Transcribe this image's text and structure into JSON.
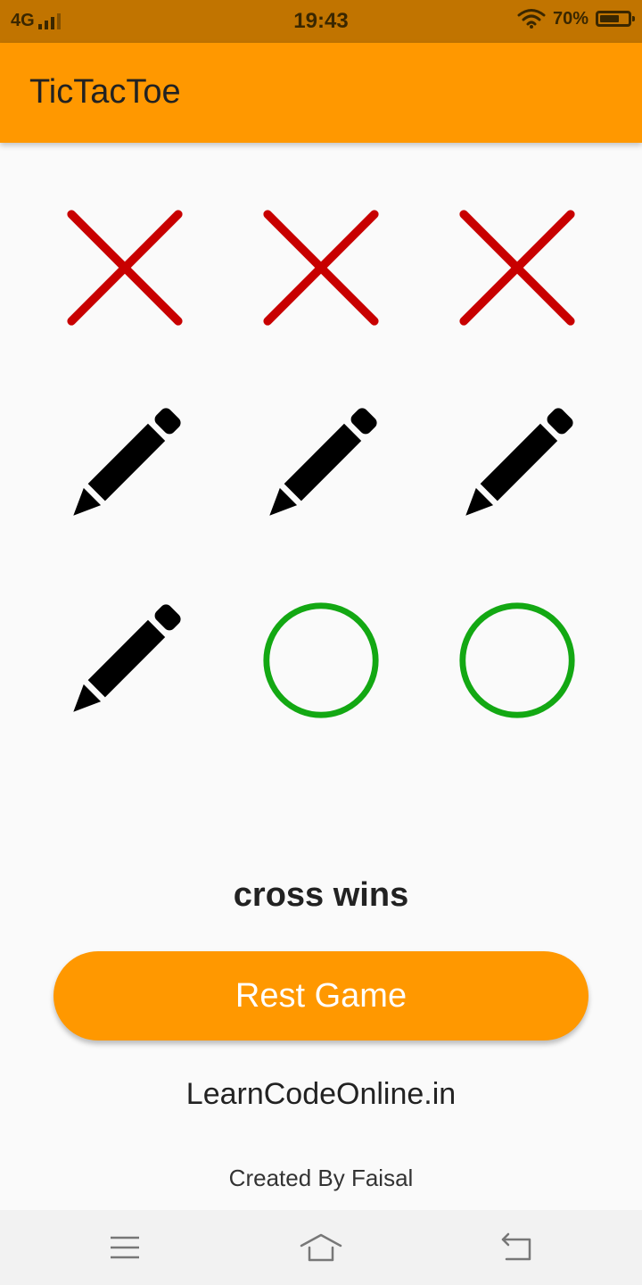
{
  "status_bar": {
    "network": "4G",
    "time": "19:43",
    "battery": "70%",
    "battery_level": 0.7
  },
  "app_bar": {
    "title": "TicTacToe"
  },
  "board": {
    "cells": [
      "cross",
      "cross",
      "cross",
      "empty",
      "empty",
      "empty",
      "empty",
      "circle",
      "circle"
    ],
    "icons": {
      "cross": "cross-icon",
      "circle": "circle-icon",
      "empty": "pencil-icon"
    },
    "colors": {
      "cross": "#c80000",
      "circle": "#13a813",
      "empty": "#000000"
    }
  },
  "result_text": "cross wins",
  "reset_button": {
    "label": "Rest Game"
  },
  "footer": {
    "site": "LearnCodeOnline.in",
    "credit": "Created By Faisal"
  },
  "nav_bar": {
    "icons": [
      "menu-icon",
      "home-icon",
      "back-icon"
    ]
  },
  "theme": {
    "primary": "#ff9800",
    "status_bar": "#c17400",
    "background": "#fafafa"
  }
}
